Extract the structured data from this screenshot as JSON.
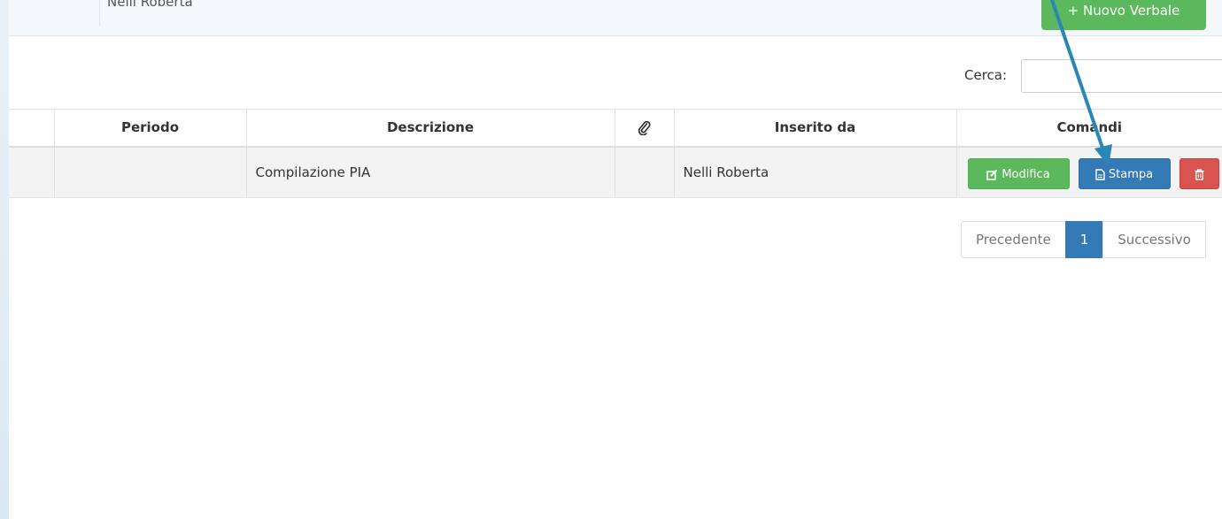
{
  "top": {
    "row_value": "Nelli Roberta",
    "new_button": "+ Nuovo Verbale"
  },
  "search": {
    "label": "Cerca:",
    "value": "",
    "placeholder": ""
  },
  "table": {
    "columns": [
      "",
      "Periodo",
      "Descrizione",
      "",
      "Inserito da",
      "Comandi"
    ],
    "rows": [
      {
        "periodo": "",
        "descrizione": "Compilazione PIA",
        "allegato": "",
        "inserito_da": "Nelli Roberta"
      }
    ]
  },
  "commands": {
    "edit": "Modifica",
    "print": "Stampa",
    "delete": ""
  },
  "pagination": {
    "previous": "Precedente",
    "current": "1",
    "next": "Successivo"
  },
  "colors": {
    "green": "#5cb85c",
    "blue": "#337ab7",
    "red": "#d9534f",
    "annotation_arrow": "#2b86b8"
  },
  "icons": [
    "paperclip-icon",
    "edit-icon",
    "file-icon",
    "trash-icon",
    "annotation-arrow"
  ]
}
